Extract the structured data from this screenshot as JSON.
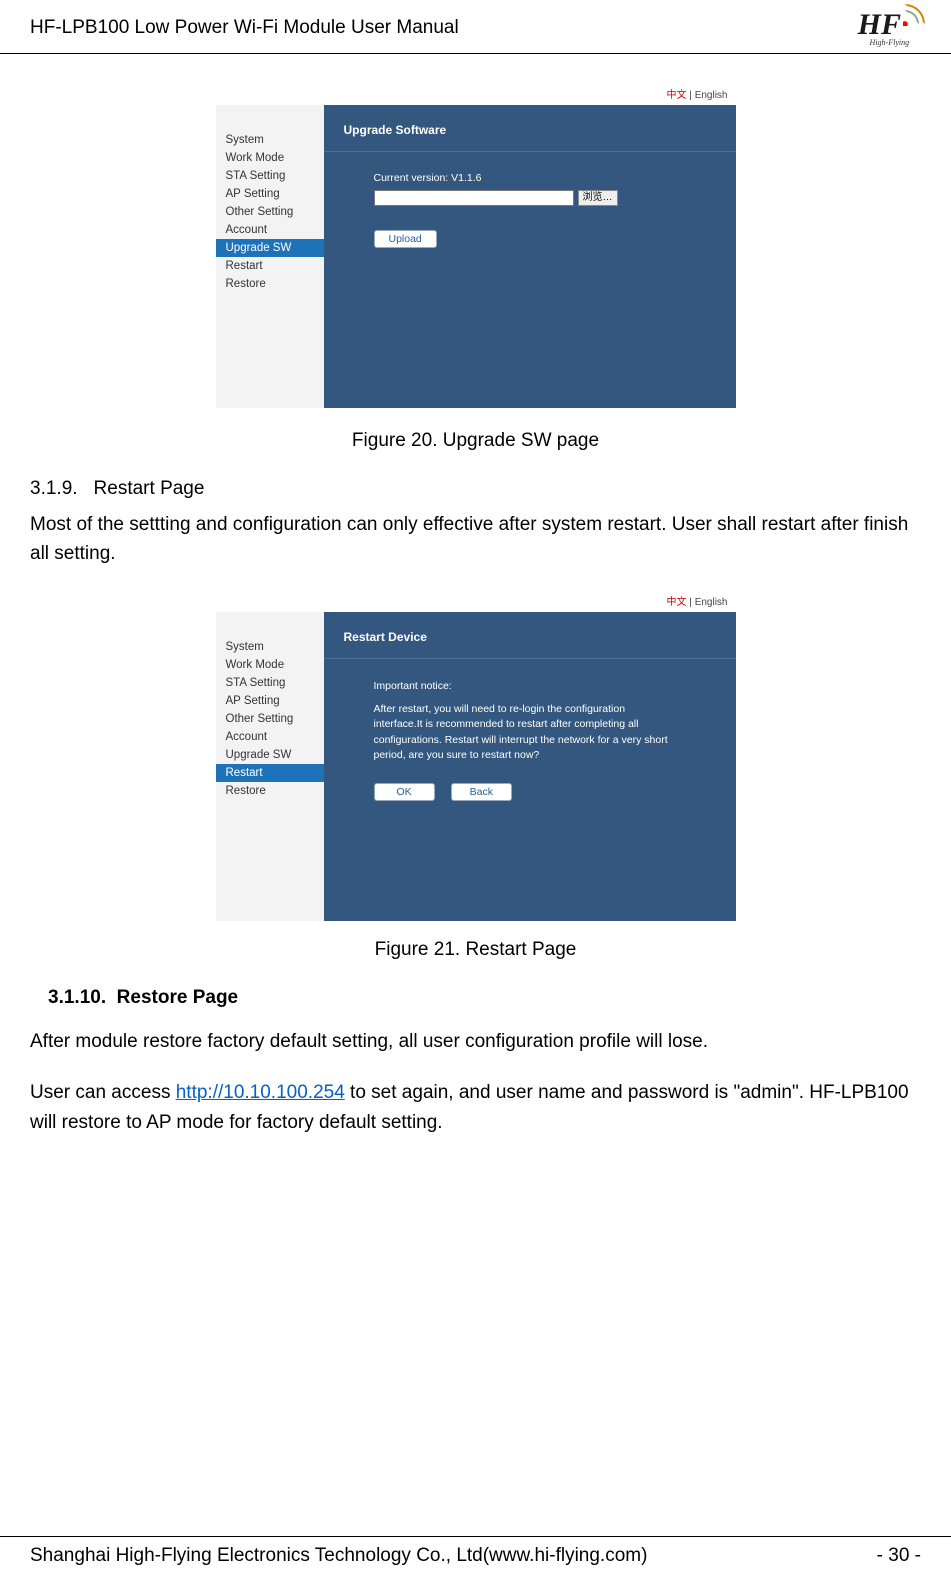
{
  "header": {
    "title": "HF-LPB100 Low Power Wi-Fi Module User Manual",
    "logo_text": "HF",
    "logo_sub": "High-Flying"
  },
  "fig1": {
    "lang_zh": "中文",
    "lang_sep": "  |  ",
    "lang_en": "English",
    "sidebar": [
      "System",
      "Work Mode",
      "STA Setting",
      "AP Setting",
      "Other Setting",
      "Account",
      "Upgrade SW",
      "Restart",
      "Restore"
    ],
    "active_index": 6,
    "panel_title": "Upgrade Software",
    "version_label": "Current version: V1.1.6",
    "browse_label": "浏览…",
    "upload_label": "Upload",
    "caption": "Figure 20.   Upgrade SW page"
  },
  "sec319": {
    "num": "3.1.9.",
    "title": "Restart Page",
    "body": "Most of the settting and configuration can only effective after system restart. User shall restart after finish all setting."
  },
  "fig2": {
    "lang_zh": "中文",
    "lang_sep": "  |  ",
    "lang_en": "English",
    "sidebar": [
      "System",
      "Work Mode",
      "STA Setting",
      "AP Setting",
      "Other Setting",
      "Account",
      "Upgrade SW",
      "Restart",
      "Restore"
    ],
    "active_index": 7,
    "panel_title": "Restart Device",
    "notice_title": "Important notice:",
    "notice_body": "After restart, you will need to re-login the configuration interface.It is recommended to restart after completing all configurations. Restart will interrupt the network for a very short period, are you sure to restart now?",
    "ok_label": "OK",
    "back_label": "Back",
    "caption": "Figure 21.   Restart Page"
  },
  "sec3110": {
    "num": "3.1.10.",
    "title": "Restore Page",
    "body1": "After module restore factory default setting, all user configuration profile will lose.",
    "body2a": "User can access ",
    "link": "http://10.10.100.254",
    "body2b": " to set again, and user name and password is \"admin\". HF-LPB100 will restore to AP mode for factory default setting."
  },
  "footer": {
    "left": "Shanghai High-Flying Electronics Technology Co., Ltd(www.hi-flying.com)",
    "right": "- 30 -"
  }
}
